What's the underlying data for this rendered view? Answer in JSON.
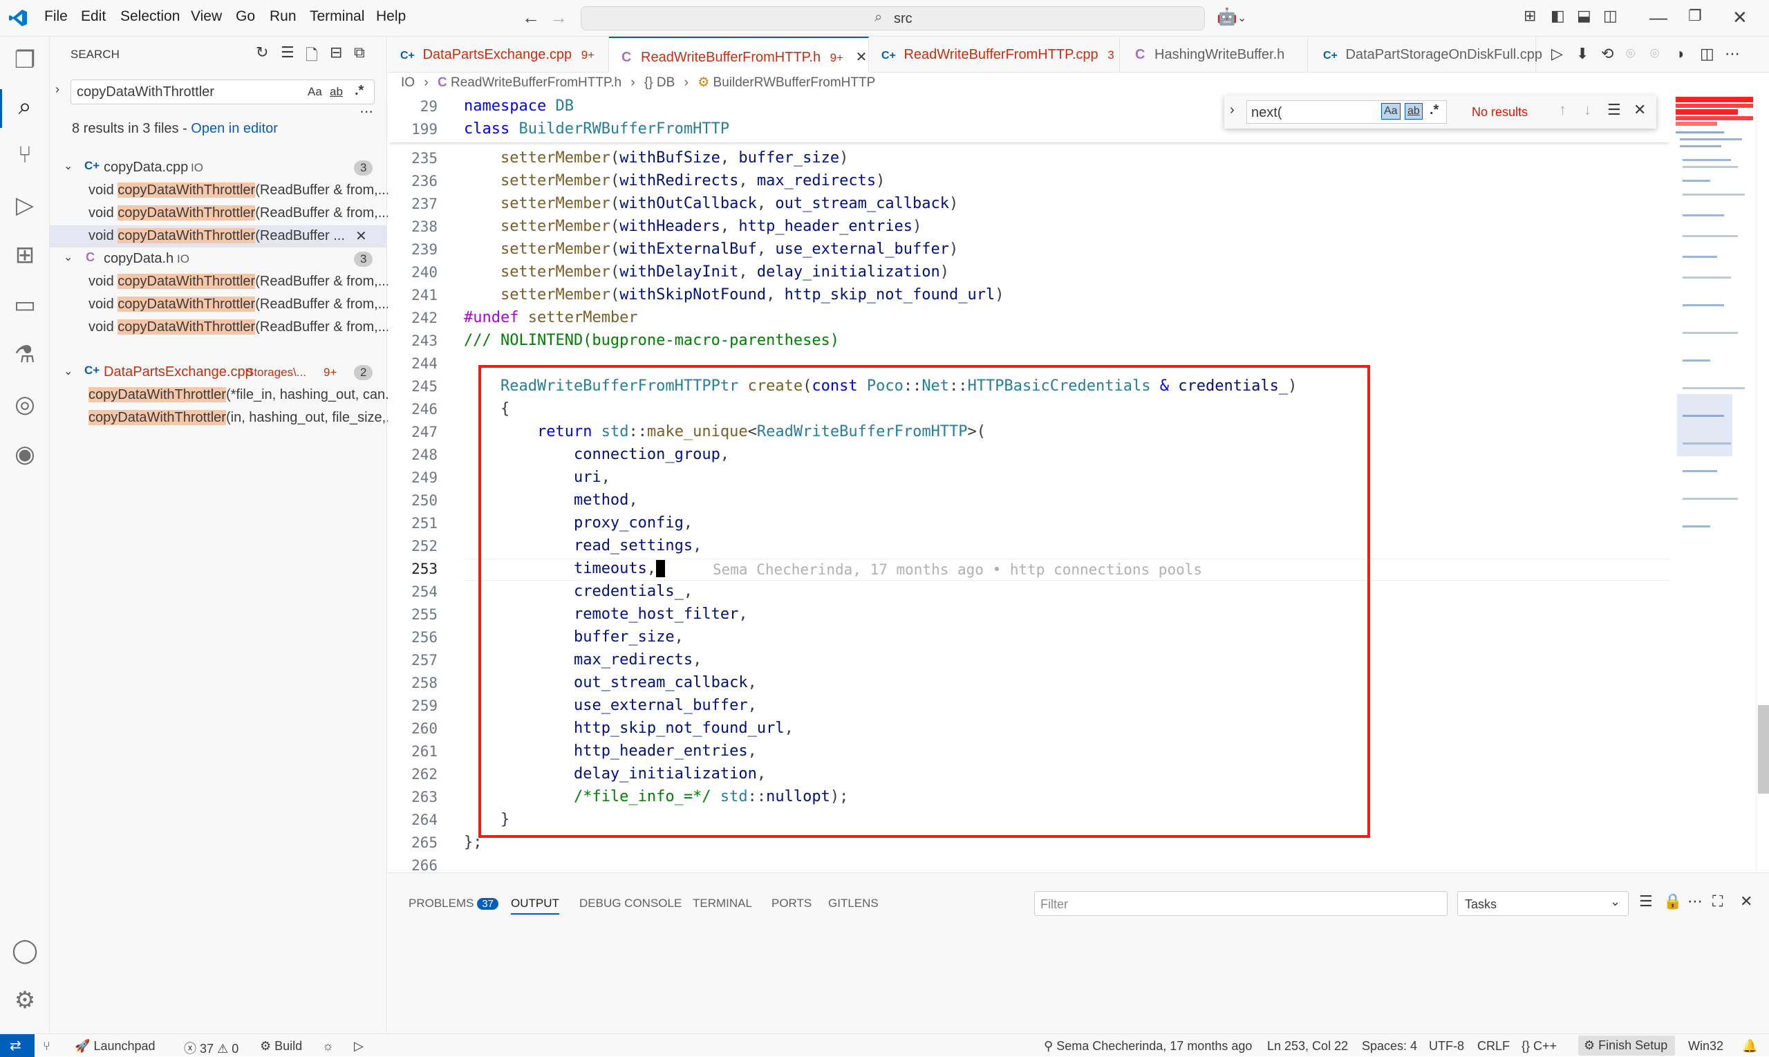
{
  "titlebar": {
    "menus": [
      "File",
      "Edit",
      "Selection",
      "View",
      "Go",
      "Run",
      "Terminal",
      "Help"
    ],
    "search_text": "src"
  },
  "sidebar": {
    "title": "SEARCH",
    "query": "copyDataWithThrottler",
    "opt_case": "Aa",
    "opt_word": "ab",
    "opt_regex": ".*",
    "summary": "8 results in 3 files - ",
    "open_editor": "Open in editor",
    "files": [
      {
        "name": "copyData.cpp",
        "path": "IO",
        "count": "3",
        "results": [
          {
            "pre": "void ",
            "match": "copyDataWithThrottler",
            "post": "(ReadBuffer & from,..."
          },
          {
            "pre": "void ",
            "match": "copyDataWithThrottler",
            "post": "(ReadBuffer & from,..."
          },
          {
            "pre": "void ",
            "match": "copyDataWithThrottler",
            "post": "(ReadBuffer ..."
          }
        ]
      },
      {
        "name": "copyData.h",
        "path": "IO",
        "count": "3",
        "results": [
          {
            "pre": "void ",
            "match": "copyDataWithThrottler",
            "post": "(ReadBuffer & from,..."
          },
          {
            "pre": "void ",
            "match": "copyDataWithThrottler",
            "post": "(ReadBuffer & from,..."
          },
          {
            "pre": "void ",
            "match": "copyDataWithThrottler",
            "post": "(ReadBuffer & from,..."
          }
        ]
      },
      {
        "name": "DataPartsExchange.cpp",
        "path": "Storages\\...",
        "problems": "9+",
        "count": "2",
        "results": [
          {
            "pre": "",
            "match": "copyDataWithThrottler",
            "post": "(*file_in, hashing_out, can..."
          },
          {
            "pre": "",
            "match": "copyDataWithThrottler",
            "post": "(in, hashing_out, file_size,..."
          }
        ]
      }
    ]
  },
  "tabs": [
    {
      "label": "DataPartsExchange.cpp",
      "badge": "9+"
    },
    {
      "label": "ReadWriteBufferFromHTTP.h",
      "badge": "9+"
    },
    {
      "label": "ReadWriteBufferFromHTTP.cpp",
      "badge": "3"
    },
    {
      "label": "HashingWriteBuffer.h",
      "badge": ""
    },
    {
      "label": "DataPartStorageOnDiskFull.cpp",
      "badge": ""
    }
  ],
  "breadcrumb": [
    "IO",
    "ReadWriteBufferFromHTTP.h",
    "{} DB",
    "BuilderRWBufferFromHTTP"
  ],
  "find": {
    "value": "next(",
    "case": "Aa",
    "word": "ab",
    "regex": ".*",
    "status": "No results"
  },
  "editor": {
    "sticky_lines": [
      "29",
      "199"
    ],
    "line_numbers": [
      "235",
      "236",
      "237",
      "238",
      "239",
      "240",
      "241",
      "242",
      "243",
      "244",
      "245",
      "246",
      "247",
      "248",
      "249",
      "250",
      "251",
      "252",
      "253",
      "254",
      "255",
      "256",
      "257",
      "258",
      "259",
      "260",
      "261",
      "262",
      "263",
      "264",
      "265",
      "266"
    ],
    "blame": "Sema Checherinda, 17 months ago • http connections pools"
  },
  "panel": {
    "tabs": [
      "PROBLEMS",
      "OUTPUT",
      "DEBUG CONSOLE",
      "TERMINAL",
      "PORTS",
      "GITLENS"
    ],
    "problems_count": "37",
    "filter_placeholder": "Filter",
    "tasks": "Tasks"
  },
  "statusbar": {
    "launchpad": "Launchpad",
    "errors": "37",
    "warnings": "0",
    "build": "Build",
    "blame": "Sema Checherinda, 17 months ago",
    "position": "Ln 253, Col 22",
    "spaces": "Spaces: 4",
    "encoding": "UTF-8",
    "eol": "CRLF",
    "language": "C++",
    "finish_setup": "Finish Setup",
    "platform": "Win32"
  },
  "colors": {
    "accent": "#005fb8",
    "highlight_box": "#f21c1c",
    "match": "#f5c6a8"
  }
}
